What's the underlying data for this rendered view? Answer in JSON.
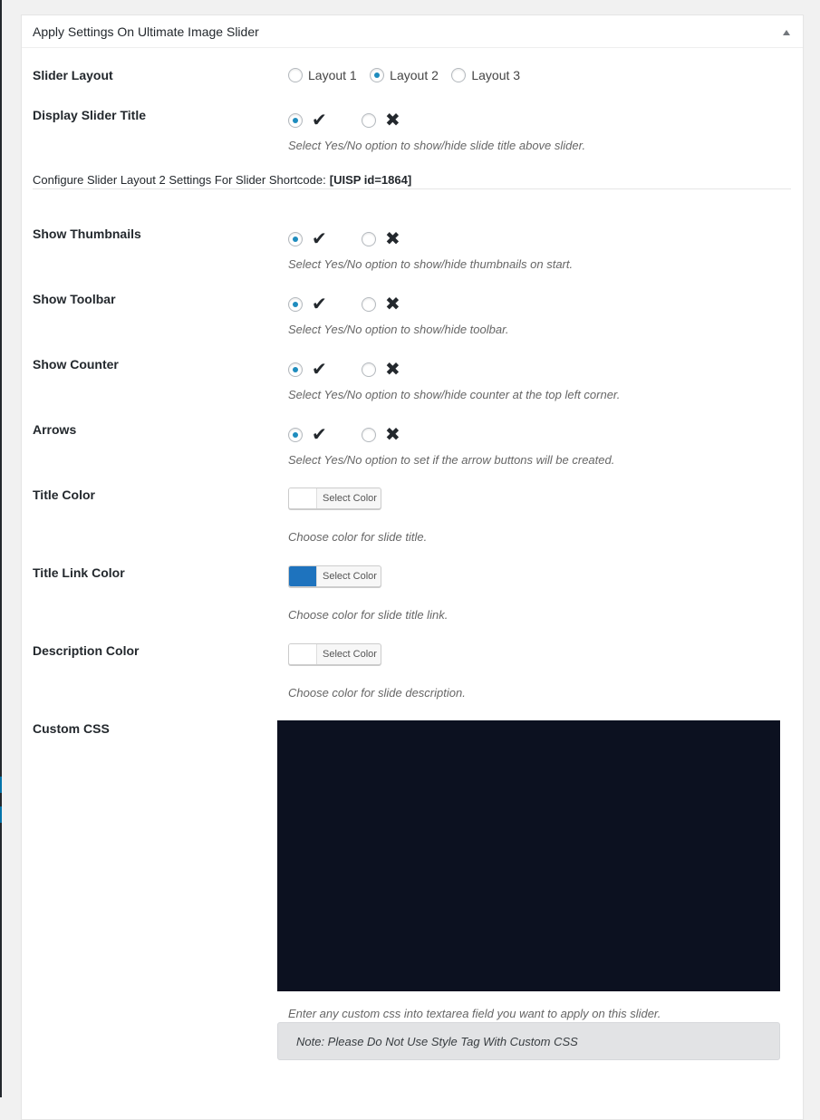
{
  "panel": {
    "title": "Apply Settings On Ultimate Image Slider",
    "toggle_icon": "triangle-up-icon"
  },
  "slider_layout": {
    "label": "Slider Layout",
    "options": [
      "Layout 1",
      "Layout 2",
      "Layout 3"
    ],
    "selected": "Layout 2"
  },
  "display_slider_title": {
    "label": "Display Slider Title",
    "yes_glyph": "✔",
    "no_glyph": "✖",
    "selected": "yes",
    "description": "Select Yes/No option to show/hide slide title above slider."
  },
  "section": {
    "heading": "Configure Slider Layout 2 Settings For Slider Shortcode:",
    "shortcode": "[UISP id=1864]"
  },
  "settings": [
    {
      "label": "Show Thumbnails",
      "selected": "yes",
      "description": "Select Yes/No option to show/hide thumbnails on start."
    },
    {
      "label": "Show Toolbar",
      "selected": "yes",
      "description": "Select Yes/No option to show/hide toolbar."
    },
    {
      "label": "Show Counter",
      "selected": "yes",
      "description": "Select Yes/No option to show/hide counter at the top left corner."
    },
    {
      "label": "Arrows",
      "selected": "yes",
      "description": "Select Yes/No option to set if the arrow buttons will be created."
    }
  ],
  "glyphs": {
    "yes": "✔",
    "no": "✖"
  },
  "colors": [
    {
      "label": "Title Color",
      "button": "Select Color",
      "value": "#ffffff",
      "description": "Choose color for slide title."
    },
    {
      "label": "Title Link Color",
      "button": "Select Color",
      "value": "#1e73be",
      "description": "Choose color for slide title link."
    },
    {
      "label": "Description Color",
      "button": "Select Color",
      "value": "#ffffff",
      "description": "Choose color for slide description."
    }
  ],
  "custom_css": {
    "label": "Custom CSS",
    "value": "",
    "description": "Enter any custom css into textarea field you want to apply on this slider.",
    "note": "Note: Please Do Not Use Style Tag With Custom CSS"
  }
}
